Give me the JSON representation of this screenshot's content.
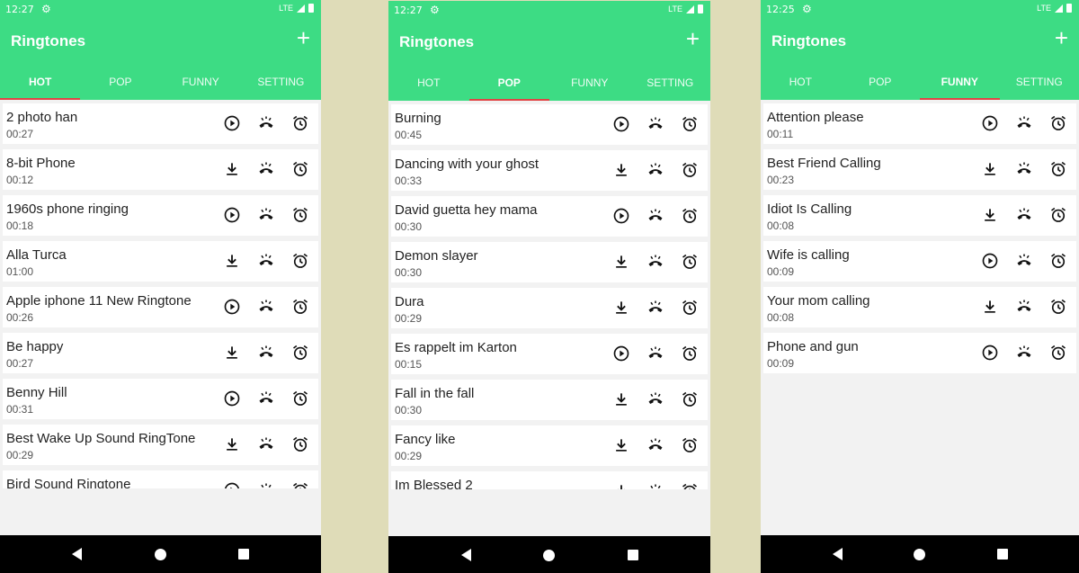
{
  "app": {
    "title": "Ringtones",
    "add_label": "+"
  },
  "tab_labels": [
    "HOT",
    "POP",
    "FUNNY",
    "SETTING"
  ],
  "status": {
    "network": "LTE"
  },
  "colors": {
    "accent": "#3ddc84",
    "tab_indicator": "#e04545",
    "backdrop": "#dfdcb8"
  },
  "screens": [
    {
      "time": "12:27",
      "active_tab": 0,
      "items": [
        {
          "name": "2 photo han",
          "duration": "00:27",
          "action": "play"
        },
        {
          "name": "8-bit Phone",
          "duration": "00:12",
          "action": "download"
        },
        {
          "name": "1960s phone ringing",
          "duration": "00:18",
          "action": "play"
        },
        {
          "name": "Alla Turca",
          "duration": "01:00",
          "action": "download"
        },
        {
          "name": "Apple iphone 11 New Ringtone",
          "duration": "00:26",
          "action": "play"
        },
        {
          "name": "Be happy",
          "duration": "00:27",
          "action": "download"
        },
        {
          "name": "Benny Hill",
          "duration": "00:31",
          "action": "play"
        },
        {
          "name": "Best Wake Up Sound RingTone",
          "duration": "00:29",
          "action": "download"
        },
        {
          "name": "Bird Sound Ringtone",
          "duration": "",
          "action": "play"
        }
      ]
    },
    {
      "time": "12:27",
      "active_tab": 1,
      "items": [
        {
          "name": "Burning",
          "duration": "00:45",
          "action": "play"
        },
        {
          "name": "Dancing with your ghost",
          "duration": "00:33",
          "action": "download"
        },
        {
          "name": "David guetta hey mama",
          "duration": "00:30",
          "action": "play"
        },
        {
          "name": "Demon slayer",
          "duration": "00:30",
          "action": "download"
        },
        {
          "name": "Dura",
          "duration": "00:29",
          "action": "download"
        },
        {
          "name": "Es rappelt im Karton",
          "duration": "00:15",
          "action": "play"
        },
        {
          "name": "Fall in the fall",
          "duration": "00:30",
          "action": "download"
        },
        {
          "name": "Fancy like",
          "duration": "00:29",
          "action": "download"
        },
        {
          "name": "Im Blessed 2",
          "duration": "",
          "action": "download"
        }
      ]
    },
    {
      "time": "12:25",
      "active_tab": 2,
      "items": [
        {
          "name": "Attention please",
          "duration": "00:11",
          "action": "play"
        },
        {
          "name": "Best Friend Calling",
          "duration": "00:23",
          "action": "download"
        },
        {
          "name": "Idiot Is Calling",
          "duration": "00:08",
          "action": "download"
        },
        {
          "name": "Wife is calling",
          "duration": "00:09",
          "action": "play"
        },
        {
          "name": "Your mom calling",
          "duration": "00:08",
          "action": "download"
        },
        {
          "name": "Phone and gun",
          "duration": "00:09",
          "action": "play"
        }
      ]
    }
  ]
}
